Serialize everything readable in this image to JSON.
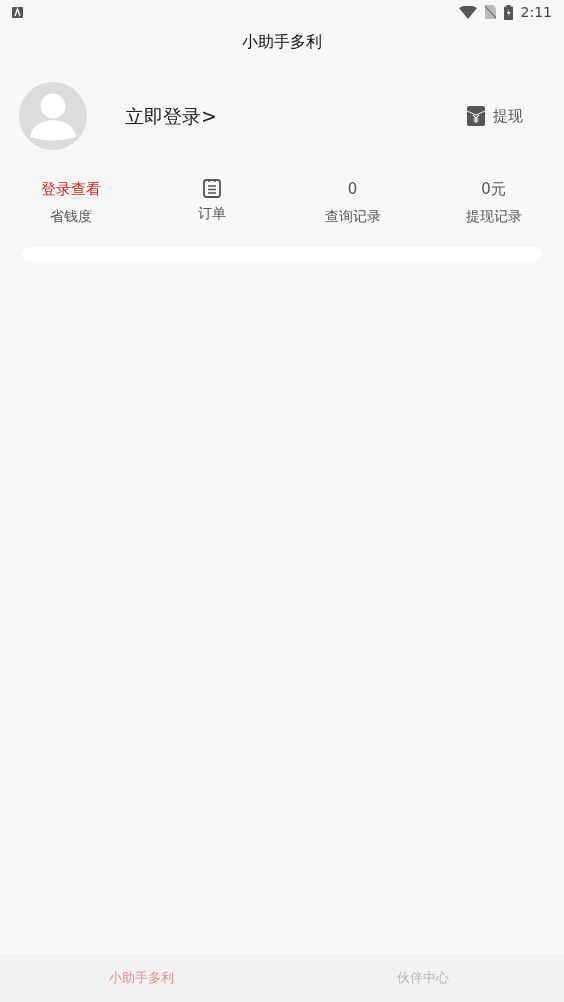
{
  "status_bar": {
    "time": "2:11"
  },
  "title": "小助手多利",
  "profile": {
    "login_link": "立即登录>",
    "withdraw_button": "提现"
  },
  "stats": [
    {
      "kind": "text",
      "value": "登录查看",
      "highlight": true,
      "label": "省钱度"
    },
    {
      "kind": "icon",
      "label": "订单"
    },
    {
      "kind": "text",
      "value": "0",
      "highlight": false,
      "label": "查询记录"
    },
    {
      "kind": "text",
      "value": "0元",
      "highlight": false,
      "label": "提现记录"
    }
  ],
  "bottom_nav": [
    {
      "label": "小助手多利",
      "selected": true
    },
    {
      "label": "伙伴中心",
      "selected": false
    }
  ]
}
